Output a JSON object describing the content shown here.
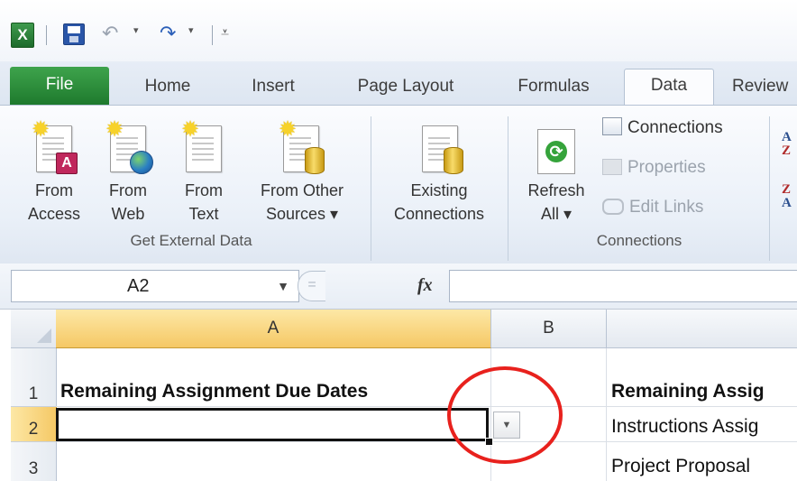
{
  "app_icon": "excel-icon",
  "quick_access": {
    "save_icon": "save-icon",
    "undo_icon": "undo-icon",
    "redo_icon": "redo-icon",
    "customize_icon": "customize-qat-icon"
  },
  "tabs": [
    {
      "label": "File"
    },
    {
      "label": "Home"
    },
    {
      "label": "Insert"
    },
    {
      "label": "Page Layout"
    },
    {
      "label": "Formulas"
    },
    {
      "label": "Data"
    },
    {
      "label": "Review"
    }
  ],
  "ribbon": {
    "get_external_data": {
      "label": "Get External Data",
      "from_access": [
        "From",
        "Access"
      ],
      "from_web": [
        "From",
        "Web"
      ],
      "from_text": [
        "From",
        "Text"
      ],
      "from_other": [
        "From Other",
        "Sources ▾"
      ]
    },
    "existing_connections": [
      "Existing",
      "Connections"
    ],
    "connections": {
      "label": "Connections",
      "refresh": [
        "Refresh",
        "All ▾"
      ],
      "connections_label": "Connections",
      "properties_label": "Properties",
      "edit_links_label": "Edit Links"
    },
    "sort": {
      "az_top": "A",
      "az_bottom": "Z",
      "za_top": "Z",
      "za_bottom": "A"
    }
  },
  "formula_bar": {
    "name_box": "A2",
    "fx": "fx",
    "formula": ""
  },
  "grid": {
    "columns": [
      "A",
      "B",
      ""
    ],
    "rows": [
      "1",
      "2",
      "3"
    ],
    "cells": {
      "A1": "Remaining Assignment Due Dates",
      "A2": "",
      "C1": "Remaining Assig",
      "C2": "Instructions Assig",
      "C3": "Project Proposal"
    }
  },
  "colors": {
    "file_tab": "#1e7a2d",
    "selection_header": "#f5c865",
    "annotation_circle": "#e8211d"
  }
}
